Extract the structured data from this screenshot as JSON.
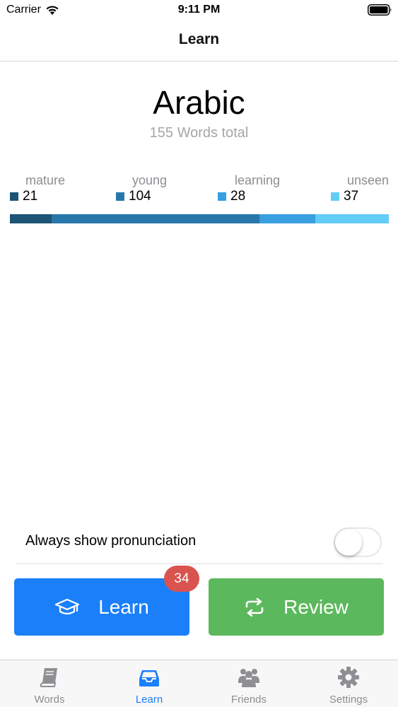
{
  "status_bar": {
    "carrier": "Carrier",
    "time": "9:11 PM"
  },
  "nav": {
    "title": "Learn"
  },
  "header": {
    "language": "Arabic",
    "words_total": "155 Words total"
  },
  "stats": [
    {
      "label": "mature",
      "value": "21",
      "color": "#1c5575",
      "count": 21
    },
    {
      "label": "young",
      "value": "104",
      "color": "#2877ab",
      "count": 104
    },
    {
      "label": "learning",
      "value": "28",
      "color": "#389fe1",
      "count": 28
    },
    {
      "label": "unseen",
      "value": "37",
      "color": "#62cef8",
      "count": 37
    }
  ],
  "settings": {
    "pronunciation_label": "Always show pronunciation",
    "pronunciation_enabled": false
  },
  "actions": {
    "learn_label": "Learn",
    "learn_badge": "34",
    "review_label": "Review",
    "learn_color": "#1a7ff9",
    "review_color": "#5cb85c",
    "badge_color": "#d9534f"
  },
  "tabs": [
    {
      "label": "Words",
      "icon": "book-icon",
      "active": false
    },
    {
      "label": "Learn",
      "icon": "inbox-icon",
      "active": true
    },
    {
      "label": "Friends",
      "icon": "users-icon",
      "active": false
    },
    {
      "label": "Settings",
      "icon": "gear-icon",
      "active": false
    }
  ]
}
